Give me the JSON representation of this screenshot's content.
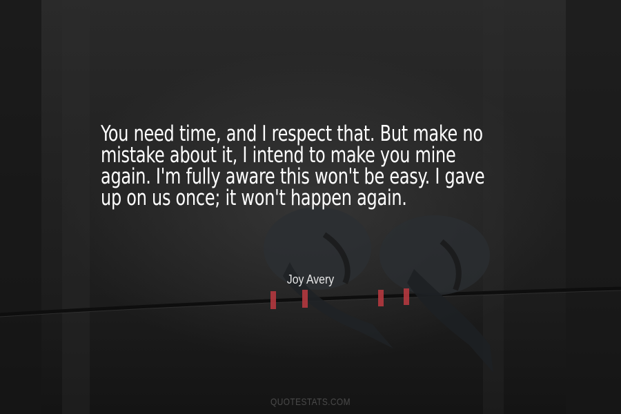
{
  "quote": {
    "lines": [
      "You need time, and I respect that. But make no",
      "mistake about it, I intend to make you mine",
      "again. I'm fully aware this won't be easy. I gave",
      "up on us once; it won't happen again."
    ]
  },
  "author": "Joy Avery",
  "watermark": "QUOTESTATS.COM",
  "colors": {
    "text": "#ffffff",
    "background": "#1c1c1c",
    "watermark": "#4a4a4a"
  }
}
